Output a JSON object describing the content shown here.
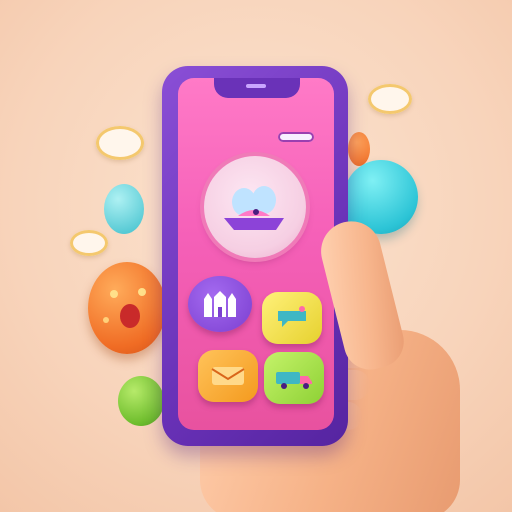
{
  "scene": {
    "description_free": true,
    "colors": {
      "background": "#f8d4bb",
      "phone_frame": "#6a32b8",
      "screen": "#f560b8",
      "accent_teal": "#2cc4d6",
      "accent_orange": "#f06c24",
      "accent_green": "#6fbe2d"
    }
  },
  "icons": {
    "feature": "bird-icon",
    "tile_1": "castle-icon",
    "tile_2": "chat-icon",
    "tile_3": "mail-icon",
    "tile_4": "truck-icon"
  }
}
